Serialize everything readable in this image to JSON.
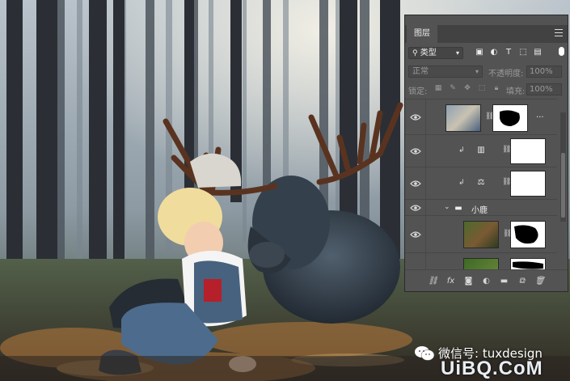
{
  "panel": {
    "tab_label": "图层",
    "filter_label": "类型",
    "blend_mode": "正常",
    "opacity_label": "不透明度:",
    "opacity_value": "100%",
    "lock_label": "锁定:",
    "fill_label": "填充:",
    "fill_value": "100%"
  },
  "layers": [
    {
      "kind": "smart-masked",
      "name": "",
      "more": "..."
    },
    {
      "kind": "adjustment-levels",
      "name": ""
    },
    {
      "kind": "adjustment-balance",
      "name": ""
    },
    {
      "kind": "group",
      "name": "小鹿"
    },
    {
      "kind": "smart-masked",
      "name": ""
    },
    {
      "kind": "smart-masked",
      "name": ""
    }
  ],
  "watermark": {
    "wechat": "微信号: tuxdesign",
    "site": "UiBQ.CoM"
  },
  "colors": {
    "panel_bg": "#535353",
    "panel_dark": "#424242",
    "text": "#dcdcdc"
  }
}
